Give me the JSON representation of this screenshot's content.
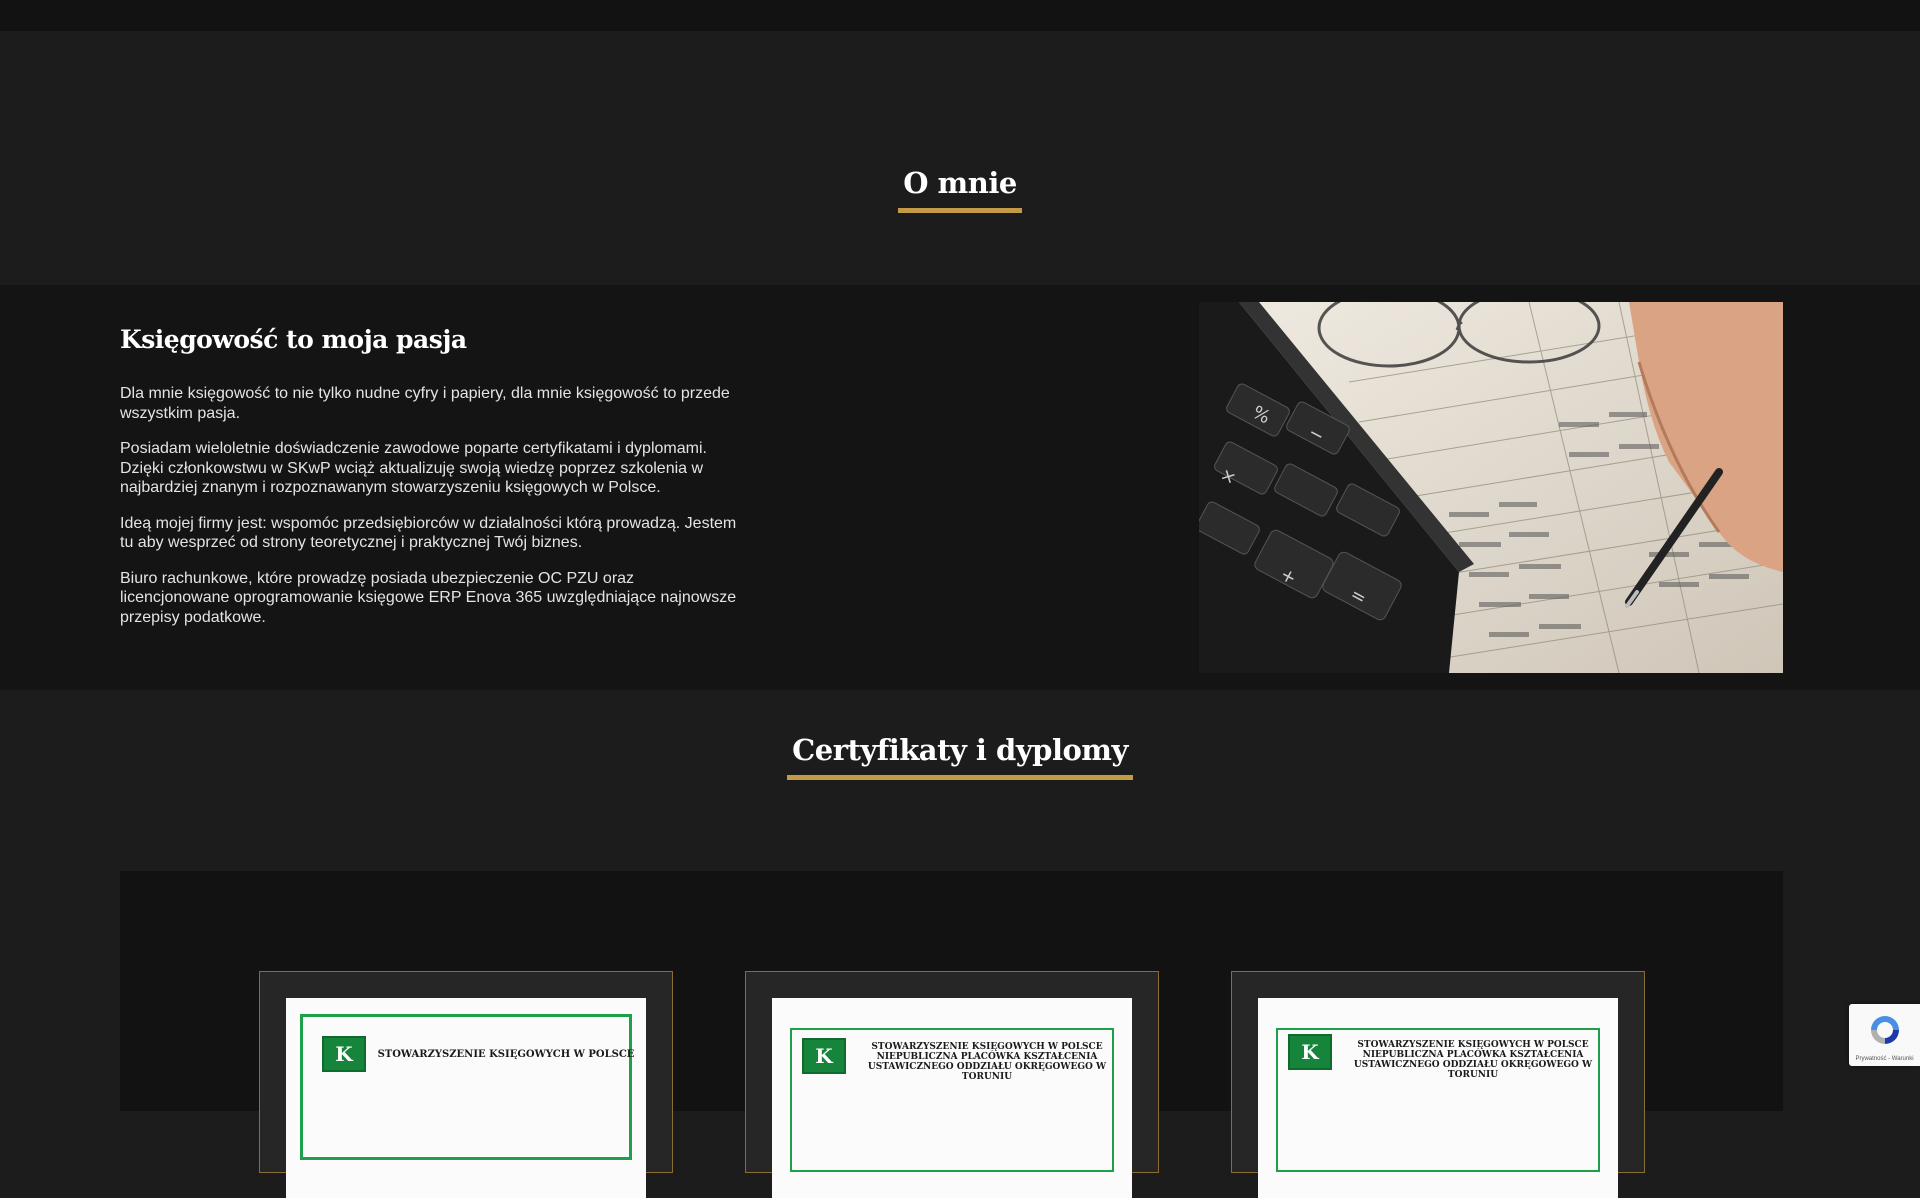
{
  "about": {
    "section_title": "O mnie",
    "heading": "Księgowość to moja pasja",
    "paragraphs": [
      "Dla mnie księgowość to nie tylko nudne cyfry i papiery, dla mnie księgowość to przede wszystkim pasja.",
      "Posiadam wieloletnie doświadczenie zawodowe poparte certyfikatami i dyplomami. Dzięki członkowstwu w SKwP wciąż aktualizuję swoją wiedzę poprzez szkolenia w najbardziej znanym i rozpoznawanym stowarzyszeniu księgowych w Polsce.",
      "Ideą mojej firmy jest: wspomóc przedsiębiorców w działalności którą prowadzą. Jestem tu aby wesprzeć od strony teoretycznej i praktycznej Twój biznes.",
      "Biuro rachunkowe, które prowadzę posiada ubezpieczenie OC PZU oraz licencjonowane oprogramowanie księgowe ERP Enova 365 uwzględniające najnowsze przepisy podatkowe."
    ]
  },
  "certificates": {
    "section_title": "Certyfikaty i dyplomy",
    "items": [
      {
        "title": "STOWARZYSZENIE KSIĘGOWYCH W POLSCE"
      },
      {
        "title": "STOWARZYSZENIE KSIĘGOWYCH W POLSCE NIEPUBLICZNA PLACÓWKA KSZTAŁCENIA USTAWICZNEGO ODDZIAŁU OKRĘGOWEGO W TORUNIU"
      },
      {
        "title": "STOWARZYSZENIE KSIĘGOWYCH W POLSCE NIEPUBLICZNA PLACÓWKA KSZTAŁCENIA USTAWICZNEGO ODDZIAŁU OKRĘGOWEGO W TORUNIU"
      }
    ],
    "logo_text": "K"
  },
  "recaptcha": {
    "text": "Prywatność - Warunki"
  },
  "colors": {
    "accent": "#c39a45",
    "background": "#1c1c1c",
    "band": "#141414",
    "cert_green": "#1ea04a"
  }
}
